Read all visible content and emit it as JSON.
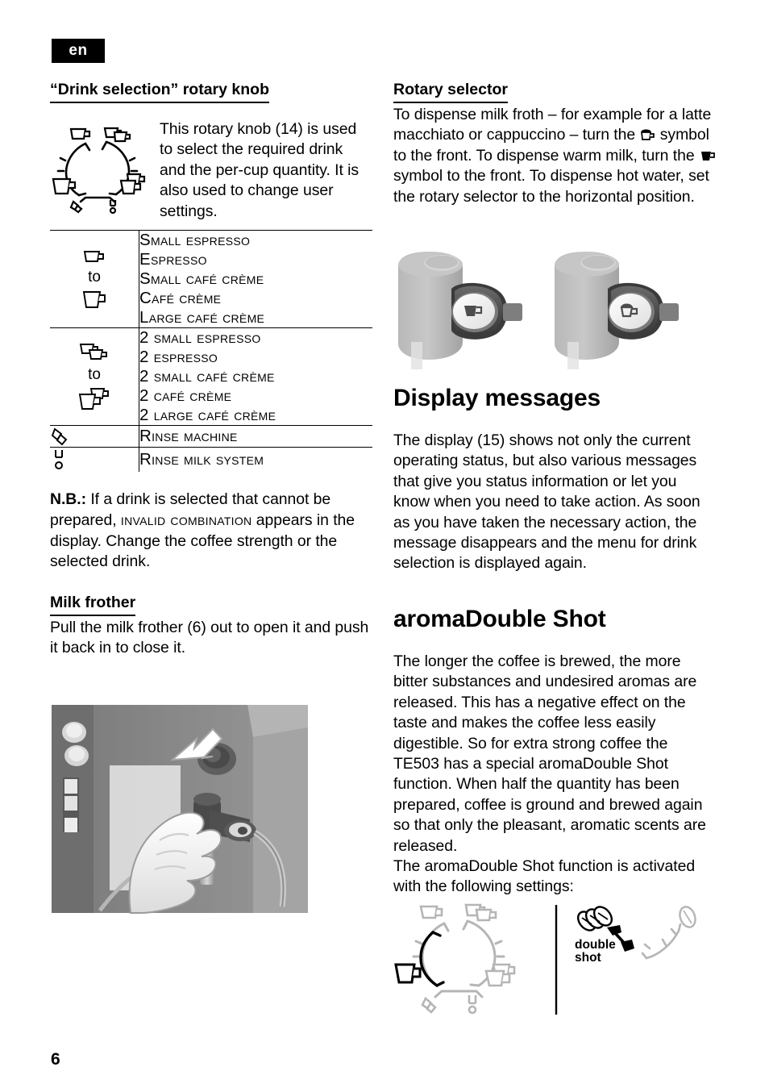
{
  "page": {
    "language_tab": "en",
    "page_number": "6"
  },
  "left_column": {
    "knob_heading": "“Drink selection” rotary knob",
    "knob_intro": "This rotary knob (14) is used to select the required drink and the per-cup quantity. It is also used to change user settings.",
    "knob_diagram_icon": "rotary-knob-dial",
    "table": {
      "rows": [
        {
          "icon_top": "single-cup-small-icon",
          "icon_middle_label": "to",
          "icon_bottom": "single-cup-large-icon",
          "labels": [
            "Small Espresso",
            "Espresso",
            "Small Café Crème",
            "Café Crème",
            "Large Café Crème"
          ]
        },
        {
          "icon_top": "double-cup-small-icon",
          "icon_middle_label": "to",
          "icon_bottom": "double-cup-large-icon",
          "labels": [
            "2 small Espresso",
            "2 Espresso",
            "2 small Café Crème",
            "2 Café Crème",
            "2 large Café Crème"
          ]
        },
        {
          "icon_top": "water-drops-icon",
          "labels": [
            "Rinse machine"
          ]
        },
        {
          "icon_top": "milk-system-drop-icon",
          "labels": [
            "Rinse milk system"
          ]
        }
      ]
    },
    "nb_prefix": "N.B.:",
    "nb_text_1": " If a drink is selected that cannot be prepared, ",
    "nb_smallcaps": "Invalid combination",
    "nb_text_2": " appears in the display. Change the coffee strength or the selected drink.",
    "milk_frother_heading": "Milk frother",
    "milk_frother_text": "Pull the milk frother (6) out to open it and push it back in to close it.",
    "milk_frother_photo": "milk-frother-photo"
  },
  "right_column": {
    "rotary_heading": "Rotary selector",
    "rotary_text_1a": "To dispense milk froth – for example for a latte macchiato or cappuccino – turn the ",
    "rotary_sym_1": "milk-froth-cup-icon",
    "rotary_text_1b": " symbol to the front.",
    "rotary_text_2a": "To dispense warm milk, turn the ",
    "rotary_sym_2": "warm-milk-cup-icon",
    "rotary_text_2b": " symbol to the front.",
    "rotary_text_3": "To dispense hot water, set the rotary selector to the horizontal position.",
    "selector_photo_left": "rotary-selector-milk-froth-photo",
    "selector_photo_right": "rotary-selector-warm-milk-photo",
    "display_heading": "Display messages",
    "display_text": "The display (15) shows not only the current operating status, but also various messages that give you status information or let you know when you need to take action. As soon as you have taken the necessary action, the message disappears and the menu for drink selection is displayed again.",
    "aroma_heading": "aromaDouble Shot",
    "aroma_text_1": "The longer the coffee is brewed, the more bitter substances and undesired aromas are released. This has a negative effect on the taste and makes the coffee less easily digestible. So for extra strong coffee the TE503 has a special aromaDouble Shot function. When half the quantity has been prepared, coffee is ground and brewed again so that only the pleasant, aromatic scents are released.",
    "aroma_text_2": "The aromaDouble Shot function is activated with the following settings:",
    "figure": {
      "dial_icon": "drink-selection-dial-highlighted",
      "strength_icon": "coffee-strength-dial-highlighted",
      "double_shot_label_line1": "double",
      "double_shot_label_line2": "shot"
    }
  }
}
